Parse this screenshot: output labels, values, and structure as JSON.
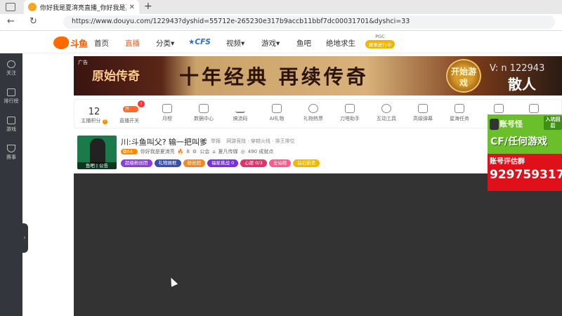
{
  "browser": {
    "tab_title": "你好我是夏淯亮直播_你好我是夏",
    "tab_close": "✕",
    "new_tab": "+",
    "back": "←",
    "reload": "↻",
    "url": "https://www.douyu.com/122943?dyshid=55712e-265230e317b9accb11bbf7dc00031701&dyshci=33"
  },
  "site_header": {
    "logo_text": "斗鱼",
    "nav": [
      "首页",
      "直播",
      "分类",
      "CFS",
      "视频",
      "游戏",
      "鱼吧",
      "绝地求生"
    ],
    "pgc_top": "PGC",
    "pgc_bottom": "赛事进行中"
  },
  "sidebar": {
    "items": [
      "关注",
      "排行榜",
      "游戏",
      "赛事"
    ],
    "collapse_icon": "›"
  },
  "banner": {
    "ad_tag": "广告",
    "game_name": "原始传奇",
    "slogan": "十年经典 再续传奇",
    "play_button": "开始游戏",
    "right_text": "散人",
    "overlay_id": "V: n 122943"
  },
  "toolbar": {
    "score_value": "12",
    "score_label": "主播积分",
    "score_hint": "?",
    "toggle_text": "开",
    "toggle_badge": "!",
    "toggle_label": "直播开关",
    "tools": [
      "月榜",
      "数据中心",
      "搞流码",
      "AI礼物",
      "礼物热票",
      "刀塔助手",
      "互动工具",
      "高级弹幕",
      "星海任务"
    ]
  },
  "room": {
    "title": "川:斗鱼叫父? 输一把叫爹",
    "report": "举报",
    "tags": "网游竞技 · 穿越火线 · 排王排位",
    "level": "84",
    "streamer": "你好我是夏淯亮",
    "hot": "8",
    "notice": "公会",
    "guild": "夏凡传媒",
    "followers": "490 成就点",
    "avatar_caption": "鱼吧 | 公告",
    "chips": [
      {
        "label": "超级粉丝团",
        "color": "#8b3fd6"
      },
      {
        "label": "礼物展框",
        "color": "#3a4fa8"
      },
      {
        "label": "粉丝团",
        "color": "#f08a24"
      },
      {
        "label": "福星挑战 0",
        "color": "#7a2fe0"
      },
      {
        "label": "心愿 0/3",
        "color": "#e0336a"
      },
      {
        "label": "全站榜",
        "color": "#ff5a8a"
      },
      {
        "label": "钻石新贵",
        "color": "#f0b800"
      }
    ]
  },
  "side_ad": {
    "account": "账号怪",
    "corner": "入坑回后",
    "cf": "CF/任何游戏",
    "eval": "账号评估群",
    "qq": "929759317"
  }
}
